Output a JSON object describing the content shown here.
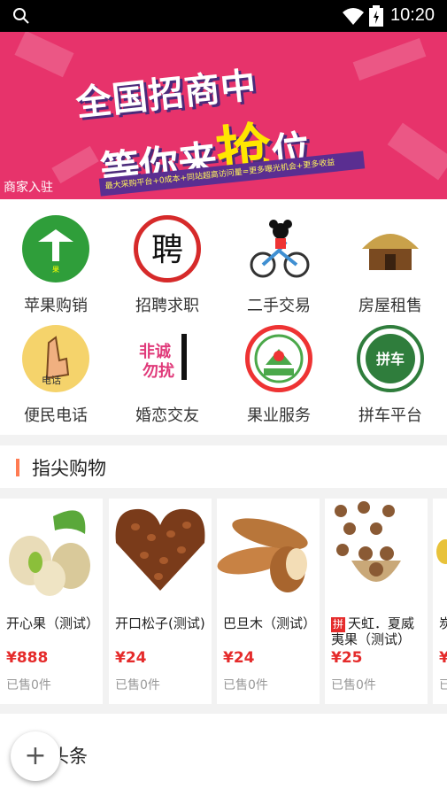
{
  "status_bar": {
    "time": "10:20"
  },
  "banner": {
    "headline_line1": "全国招商中",
    "headline_line2_prefix": "等你来",
    "headline_line2_highlight": "抢",
    "headline_line2_suffix": "位",
    "subline": "最大采购平台+0成本+同站超高访问量=更多曝光机会+更多收益",
    "corner_label": "商家入驻"
  },
  "categories": [
    {
      "label": "苹果购销",
      "icon": "apple-trade-icon",
      "color": "#2f9e3a"
    },
    {
      "label": "招聘求职",
      "icon": "recruit-icon",
      "color": "#d62a2a"
    },
    {
      "label": "二手交易",
      "icon": "bike-mouse-icon",
      "color": "#3f8fd2"
    },
    {
      "label": "房屋租售",
      "icon": "house-icon",
      "color": "#c9a14a"
    },
    {
      "label": "便民电话",
      "icon": "phone-hand-icon",
      "color": "#f5d36b"
    },
    {
      "label": "婚恋交友",
      "icon": "dating-icon",
      "color": "#e03a7a"
    },
    {
      "label": "果业服务",
      "icon": "fruit-service-icon",
      "color": "#4ba84a"
    },
    {
      "label": "拼车平台",
      "icon": "carpool-icon",
      "color": "#2f7d3c"
    }
  ],
  "section": {
    "title": "指尖购物"
  },
  "products": [
    {
      "name": "开心果（测试）",
      "price": "¥888",
      "sold": "已售0件",
      "tag": ""
    },
    {
      "name": "开口松子(测试)",
      "price": "¥24",
      "sold": "已售0件",
      "tag": ""
    },
    {
      "name": "巴旦木（测试）",
      "price": "¥24",
      "sold": "已售0件",
      "tag": ""
    },
    {
      "name": "天虹．夏威夷果（测试）",
      "price": "¥25",
      "sold": "已售0件",
      "tag": "拼"
    },
    {
      "name": "炭试",
      "price": "¥",
      "sold": "已售",
      "tag": ""
    }
  ],
  "bottom_section": {
    "title": "川头条"
  },
  "fab": {
    "symbol": "+"
  }
}
